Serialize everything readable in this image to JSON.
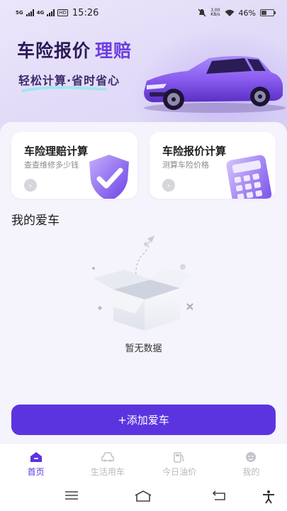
{
  "status_bar": {
    "network_1": "5G",
    "network_2": "4G",
    "hd": "HD",
    "time": "15:26",
    "speed_value": "3.00",
    "speed_unit": "KB/s",
    "battery": "46%",
    "battery_level": 0.46
  },
  "hero": {
    "title": "车险报价",
    "title_accent": "理赔",
    "subtitle": "轻松计算·省时省心",
    "car_color": "#8a5cf0"
  },
  "cards": [
    {
      "title": "车险理赔计算",
      "desc": "查查维修多少钱",
      "art": "shield-check-icon"
    },
    {
      "title": "车险报价计算",
      "desc": "测算车险价格",
      "art": "calculator-icon"
    }
  ],
  "my_car": {
    "title": "我的爱车",
    "empty_text": "暂无数据"
  },
  "add_button": "+添加爱车",
  "tabs": [
    {
      "label": "首页",
      "icon": "home-icon",
      "active": true
    },
    {
      "label": "生活用车",
      "icon": "car-icon",
      "active": false
    },
    {
      "label": "今日油价",
      "icon": "fuel-icon",
      "active": false
    },
    {
      "label": "我的",
      "icon": "profile-icon",
      "active": false
    }
  ],
  "colors": {
    "accent": "#5b34e0",
    "title": "#2b1a55",
    "hero_accent": "#6d3fe0"
  }
}
